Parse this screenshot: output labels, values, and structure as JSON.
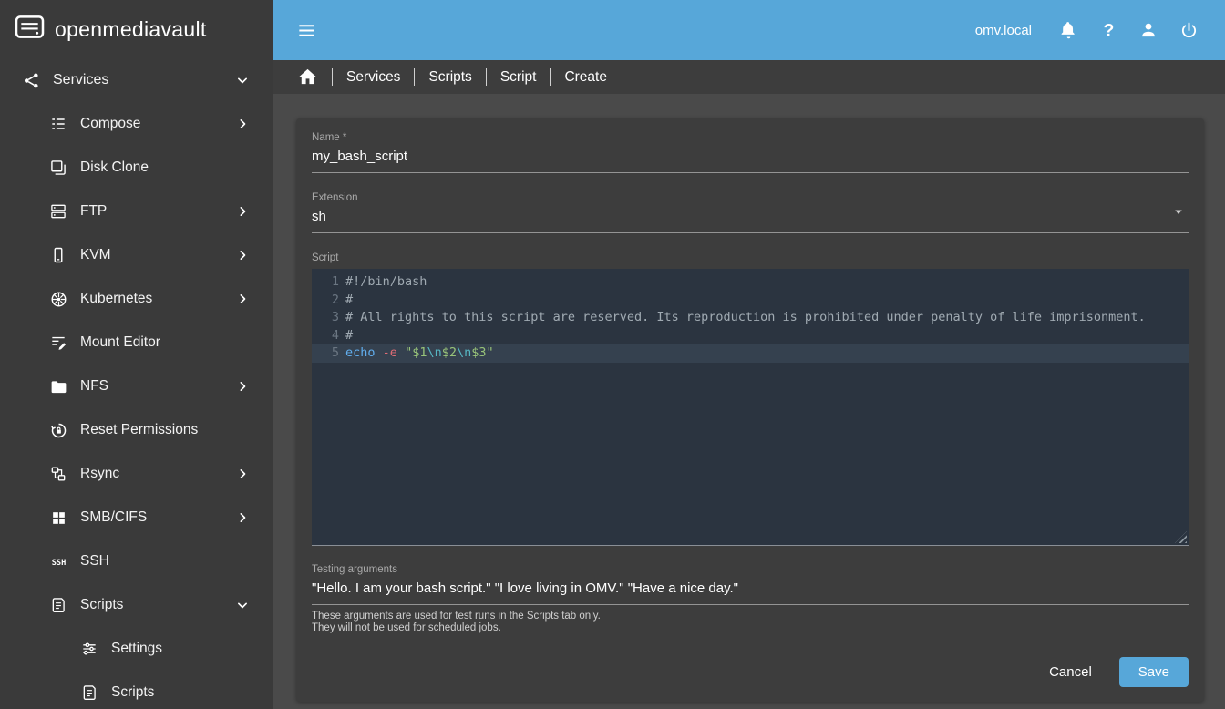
{
  "app": {
    "title": "openmediavault",
    "host": "omv.local"
  },
  "sidebar": {
    "items": [
      {
        "label": "Services",
        "icon": "share-icon",
        "level": 0,
        "chevron": "down"
      },
      {
        "label": "Compose",
        "icon": "compose-icon",
        "level": 1,
        "chevron": "right"
      },
      {
        "label": "Disk Clone",
        "icon": "disk-clone-icon",
        "level": 1
      },
      {
        "label": "FTP",
        "icon": "server-icon",
        "level": 1,
        "chevron": "right"
      },
      {
        "label": "KVM",
        "icon": "kvm-icon",
        "level": 1,
        "chevron": "right"
      },
      {
        "label": "Kubernetes",
        "icon": "kubernetes-icon",
        "level": 1,
        "chevron": "right"
      },
      {
        "label": "Mount Editor",
        "icon": "mount-editor-icon",
        "level": 1
      },
      {
        "label": "NFS",
        "icon": "folder-icon",
        "level": 1,
        "chevron": "right"
      },
      {
        "label": "Reset Permissions",
        "icon": "lock-reset-icon",
        "level": 1
      },
      {
        "label": "Rsync",
        "icon": "network-sync-icon",
        "level": 1,
        "chevron": "right"
      },
      {
        "label": "SMB/CIFS",
        "icon": "windows-icon",
        "level": 1,
        "chevron": "right"
      },
      {
        "label": "SSH",
        "icon": "ssh-icon",
        "level": 1
      },
      {
        "label": "Scripts",
        "icon": "script-icon",
        "level": 1,
        "chevron": "down"
      },
      {
        "label": "Settings",
        "icon": "tune-icon",
        "level": 2
      },
      {
        "label": "Scripts",
        "icon": "script-icon",
        "level": 2
      }
    ]
  },
  "breadcrumb": {
    "items": [
      "Services",
      "Scripts",
      "Script",
      "Create"
    ]
  },
  "form": {
    "name": {
      "label": "Name *",
      "value": "my_bash_script"
    },
    "extension": {
      "label": "Extension",
      "value": "sh"
    },
    "script": {
      "label": "Script",
      "lines": [
        {
          "num": "1",
          "tokens": [
            {
              "type": "comment",
              "text": "#!/bin/bash"
            }
          ]
        },
        {
          "num": "2",
          "tokens": [
            {
              "type": "comment",
              "text": "#"
            }
          ]
        },
        {
          "num": "3",
          "tokens": [
            {
              "type": "comment",
              "text": "# All rights to this script are reserved. Its reproduction is prohibited under penalty of life imprisonment."
            }
          ]
        },
        {
          "num": "4",
          "tokens": [
            {
              "type": "comment",
              "text": "#"
            }
          ]
        },
        {
          "num": "5",
          "active": true,
          "tokens": [
            {
              "type": "builtin",
              "text": "echo"
            },
            {
              "type": "plain",
              "text": " "
            },
            {
              "type": "flag",
              "text": "-e"
            },
            {
              "type": "plain",
              "text": " "
            },
            {
              "type": "string",
              "text": "\"$1"
            },
            {
              "type": "escape",
              "text": "\\n"
            },
            {
              "type": "string",
              "text": "$2"
            },
            {
              "type": "escape",
              "text": "\\n"
            },
            {
              "type": "string",
              "text": "$3\""
            }
          ]
        }
      ]
    },
    "testing_arguments": {
      "label": "Testing arguments",
      "value": "\"Hello. I am your bash script.\" \"I love living in OMV.\" \"Have a nice day.\"",
      "hints": [
        "These arguments are used for test runs in the Scripts tab only.",
        "They will not be used for scheduled jobs."
      ]
    },
    "buttons": {
      "cancel": "Cancel",
      "save": "Save"
    }
  },
  "colors": {
    "accent": "#57a7d9",
    "topbar_bg": "#57a7d9",
    "sidebar_bg": "#3a3a3a",
    "breadcrumb_bg": "#3d3d3d",
    "content_bg": "#4a4a4a",
    "card_bg": "#3d3d3d",
    "editor_bg": "#2b3440",
    "editor_active_line_bg": "#35414f",
    "syntax_comment": "#a0aab2",
    "syntax_builtin": "#61aeee",
    "syntax_flag": "#e06c75",
    "syntax_string": "#98c379",
    "syntax_escape": "#56b6c2"
  }
}
